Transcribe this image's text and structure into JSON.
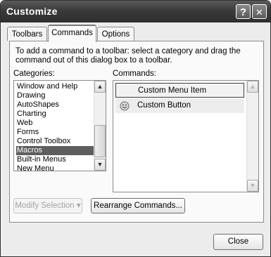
{
  "window": {
    "title": "Customize",
    "help_button": "?",
    "close_glyph": "✕"
  },
  "tabs": [
    {
      "label": "Toolbars",
      "active": false
    },
    {
      "label": "Commands",
      "active": true
    },
    {
      "label": "Options",
      "active": false
    }
  ],
  "instruction": "To add a command to a toolbar: select a category and drag the command out of this dialog box to a toolbar.",
  "categories": {
    "label": "Categories:",
    "items": [
      "Window and Help",
      "Drawing",
      "AutoShapes",
      "Charting",
      "Web",
      "Forms",
      "Control Toolbox",
      "Macros",
      "Built-in Menus",
      "New Menu"
    ],
    "selected": "Macros"
  },
  "commands": {
    "label": "Commands:",
    "items": [
      {
        "label": "Custom Menu Item",
        "icon": ""
      },
      {
        "label": "Custom Button",
        "icon": "smiley-icon"
      }
    ]
  },
  "buttons": {
    "modify_selection": "Modify Selection",
    "rearrange": "Rearrange Commands...",
    "close": "Close"
  },
  "icons": {
    "scroll_up": "▲",
    "scroll_down": "▼",
    "dropdown": "▾"
  }
}
